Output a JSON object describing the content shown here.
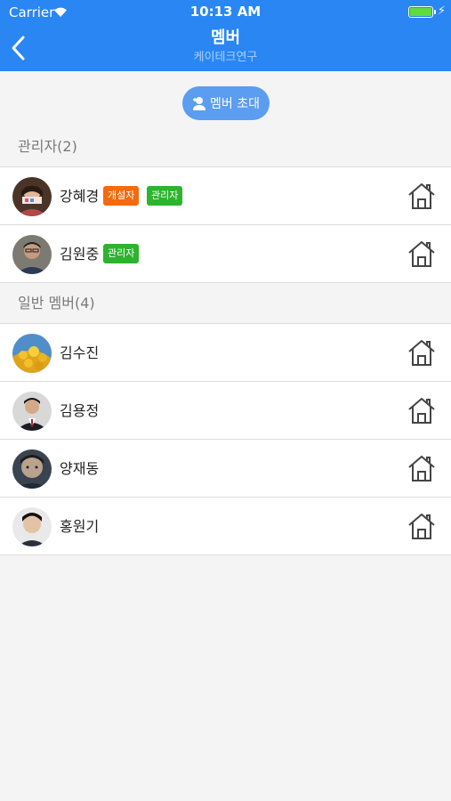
{
  "status_bar": {
    "carrier": "Carrier",
    "time": "10:13 AM"
  },
  "nav": {
    "title": "멤버",
    "subtitle": "케이테크연구"
  },
  "invite": {
    "label": "멤버 초대"
  },
  "admins": {
    "header": "관리자(2)",
    "members": [
      {
        "name": "강혜경",
        "badges": [
          "개설자",
          "관리자"
        ]
      },
      {
        "name": "김원중",
        "badges": [
          "관리자"
        ]
      }
    ]
  },
  "general": {
    "header": "일반 멤버(4)",
    "members": [
      {
        "name": "김수진"
      },
      {
        "name": "김용정"
      },
      {
        "name": "양재동"
      },
      {
        "name": "홍원기"
      }
    ]
  },
  "colors": {
    "header_blue": "#2a86f3",
    "founder_badge": "#f46a0d",
    "admin_badge": "#2cb42c"
  }
}
